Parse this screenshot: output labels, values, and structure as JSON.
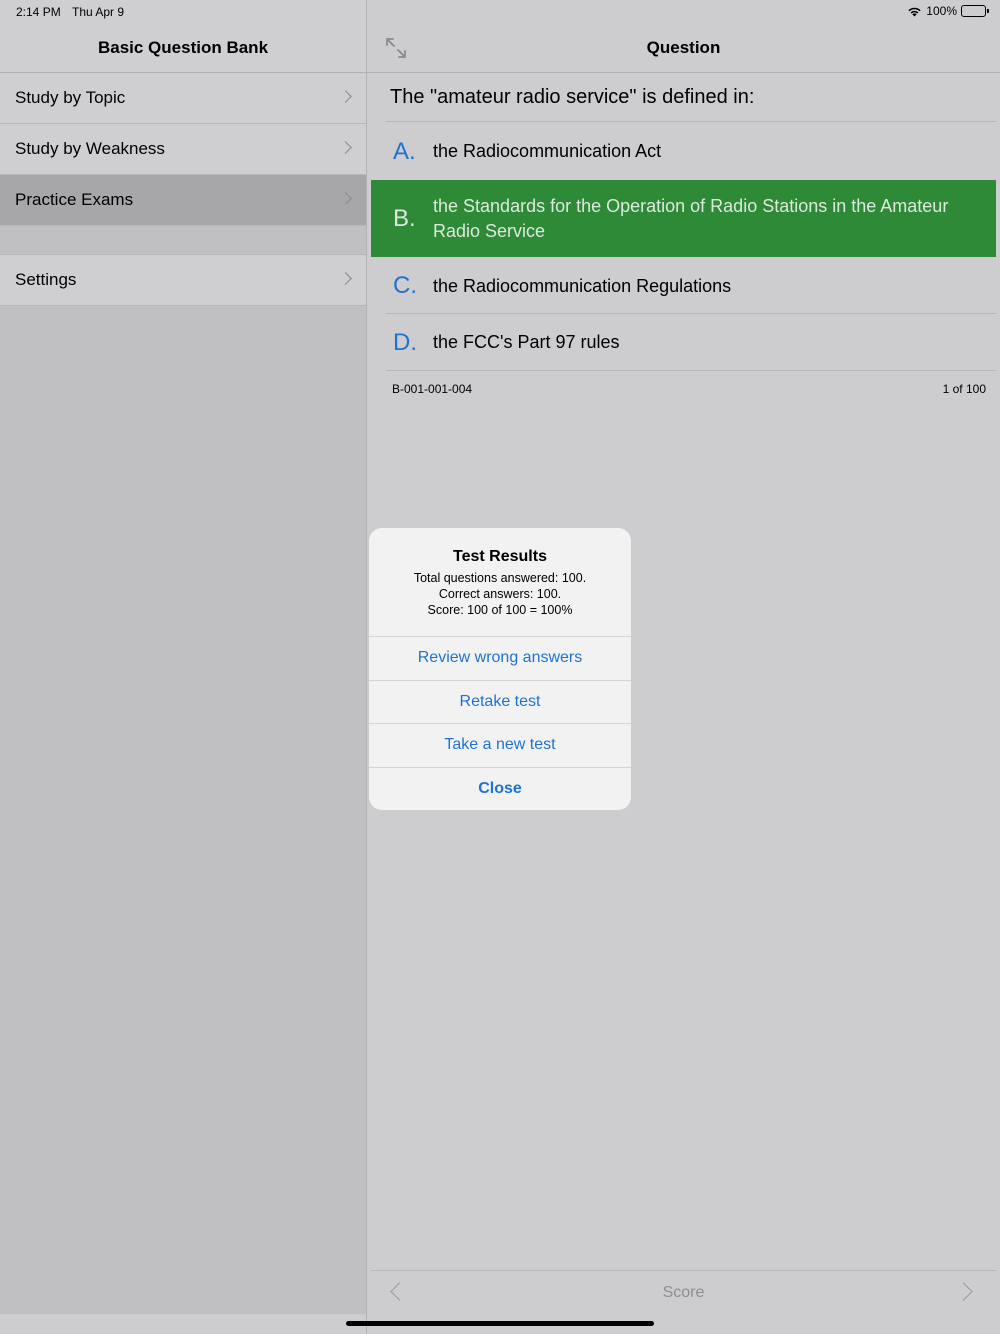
{
  "status_bar": {
    "time": "2:14 PM",
    "date": "Thu Apr 9",
    "battery": "100%"
  },
  "sidebar": {
    "title": "Basic Question Bank",
    "items": [
      {
        "label": "Study by Topic"
      },
      {
        "label": "Study by Weakness"
      },
      {
        "label": "Practice Exams",
        "selected": true
      },
      {
        "label": "Settings"
      }
    ]
  },
  "detail": {
    "title": "Question",
    "question": "The \"amateur radio service\" is defined in:",
    "answers": [
      {
        "letter": "A.",
        "text": "the Radiocommunication Act"
      },
      {
        "letter": "B.",
        "text": "the Standards for the Operation of Radio Stations in the Amateur Radio Service",
        "correct": true
      },
      {
        "letter": "C.",
        "text": "the Radiocommunication Regulations"
      },
      {
        "letter": "D.",
        "text": "the FCC's Part 97 rules"
      }
    ],
    "question_id": "B-001-001-004",
    "position": "1 of 100"
  },
  "toolbar": {
    "score_label": "Score"
  },
  "alert": {
    "title": "Test Results",
    "line1": "Total questions answered: 100.",
    "line2": "Correct answers: 100.",
    "line3": "Score: 100 of 100 = 100%",
    "buttons": [
      {
        "label": "Review wrong answers"
      },
      {
        "label": "Retake test"
      },
      {
        "label": "Take a new test"
      },
      {
        "label": "Close"
      }
    ]
  },
  "colors": {
    "accent": "#1f72d3",
    "correct": "#2f8a38"
  }
}
